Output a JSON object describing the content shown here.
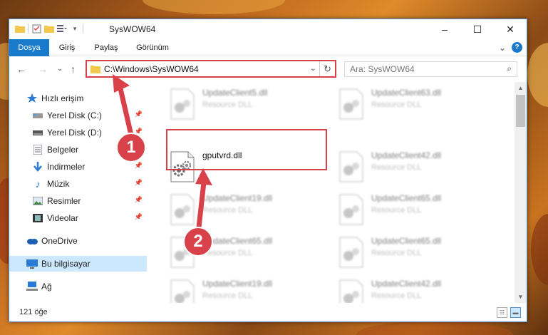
{
  "window": {
    "title": "SysWOW64",
    "controls": {
      "minimize": "–",
      "maximize": "☐",
      "close": "✕"
    }
  },
  "ribbon": {
    "tabs": [
      "Dosya",
      "Giriş",
      "Paylaş",
      "Görünüm"
    ],
    "active_tab": "Dosya",
    "expand_glyph": "⌄",
    "help_glyph": "?"
  },
  "navigation": {
    "back": "←",
    "forward": "→",
    "recent": "⌄",
    "up": "↑",
    "address": "C:\\Windows\\SysWOW64",
    "address_dropdown": "⌄",
    "refresh": "↻",
    "search_placeholder": "Ara: SysWOW64"
  },
  "sidebar": {
    "items": [
      {
        "label": "Hızlı erişim",
        "icon": "star-icon",
        "pinned": false
      },
      {
        "label": "Yerel Disk (C:)",
        "icon": "drive-icon",
        "pinned": true
      },
      {
        "label": "Yerel Disk (D:)",
        "icon": "drive-icon",
        "pinned": true
      },
      {
        "label": "Belgeler",
        "icon": "documents-icon",
        "pinned": true
      },
      {
        "label": "İndirmeler",
        "icon": "download-icon",
        "pinned": true
      },
      {
        "label": "Müzik",
        "icon": "music-icon",
        "pinned": true
      },
      {
        "label": "Resimler",
        "icon": "pictures-icon",
        "pinned": true
      },
      {
        "label": "Videolar",
        "icon": "videos-icon",
        "pinned": true
      },
      {
        "label": "OneDrive",
        "icon": "cloud-icon",
        "pinned": false
      },
      {
        "label": "Bu bilgisayar",
        "icon": "computer-icon",
        "pinned": false,
        "selected": true
      },
      {
        "label": "Ağ",
        "icon": "network-icon",
        "pinned": false
      }
    ]
  },
  "files": [
    {
      "name": "UpdateClient5.dll",
      "type": "Resource DLL",
      "blurred": true
    },
    {
      "name": "UpdateClient63.dll",
      "type": "Resource DLL",
      "blurred": true
    },
    {
      "name": "gputvrd.dll",
      "type": "",
      "blurred": false,
      "highlighted": true
    },
    {
      "name": "UpdateClient42.dll",
      "type": "Resource DLL",
      "blurred": true
    },
    {
      "name": "UpdateClient19.dll",
      "type": "Resource DLL",
      "blurred": true
    },
    {
      "name": "UpdateClient65.dll",
      "type": "Resource DLL",
      "blurred": true
    },
    {
      "name": "UpdateClient65.dll",
      "type": "Resource DLL",
      "blurred": true
    },
    {
      "name": "UpdateClient65.dll",
      "type": "Resource DLL",
      "blurred": true
    },
    {
      "name": "UpdateClient19.dll",
      "type": "Resource DLL",
      "blurred": true
    },
    {
      "name": "UpdateClient42.dll",
      "type": "Resource DLL",
      "blurred": true
    }
  ],
  "status": {
    "count": "121 öğe"
  },
  "annotations": {
    "step1": "1",
    "step2": "2"
  },
  "colors": {
    "accent": "#1979ca",
    "highlight": "#d9414a",
    "selection": "#cce8ff"
  }
}
